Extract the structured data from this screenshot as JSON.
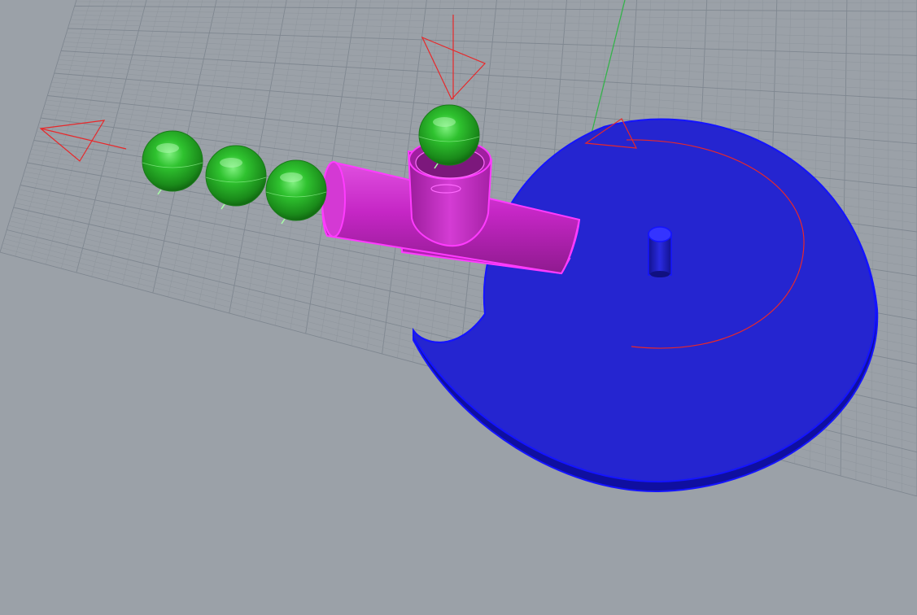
{
  "viewport": {
    "view": "Perspective",
    "background_color": "#9ba1a8",
    "grid_visible": true,
    "grid_minor_color": "#8e959c",
    "grid_major_color": "#7f8790",
    "y_axis_color": "#34b34a"
  },
  "scene_objects": [
    {
      "name": "disc",
      "color": "#2525d0",
      "edge_color": "#1414ff",
      "selected": false
    },
    {
      "name": "shaft",
      "color": "#1d1db8",
      "selected": false
    },
    {
      "name": "feeder-tube",
      "color": "#c526c5",
      "edge_color": "#ff3bff",
      "selected": true
    },
    {
      "name": "hopper-cup",
      "color": "#c526c5",
      "edge_color": "#ff3bff",
      "selected": true
    },
    {
      "name": "ball",
      "count": 4,
      "color": "#1fa21f",
      "selected": false
    }
  ],
  "annotations": {
    "arrow_color": "#e8282a",
    "arrows": [
      "left-arrow",
      "down-arrow",
      "rotation-arrow"
    ]
  }
}
